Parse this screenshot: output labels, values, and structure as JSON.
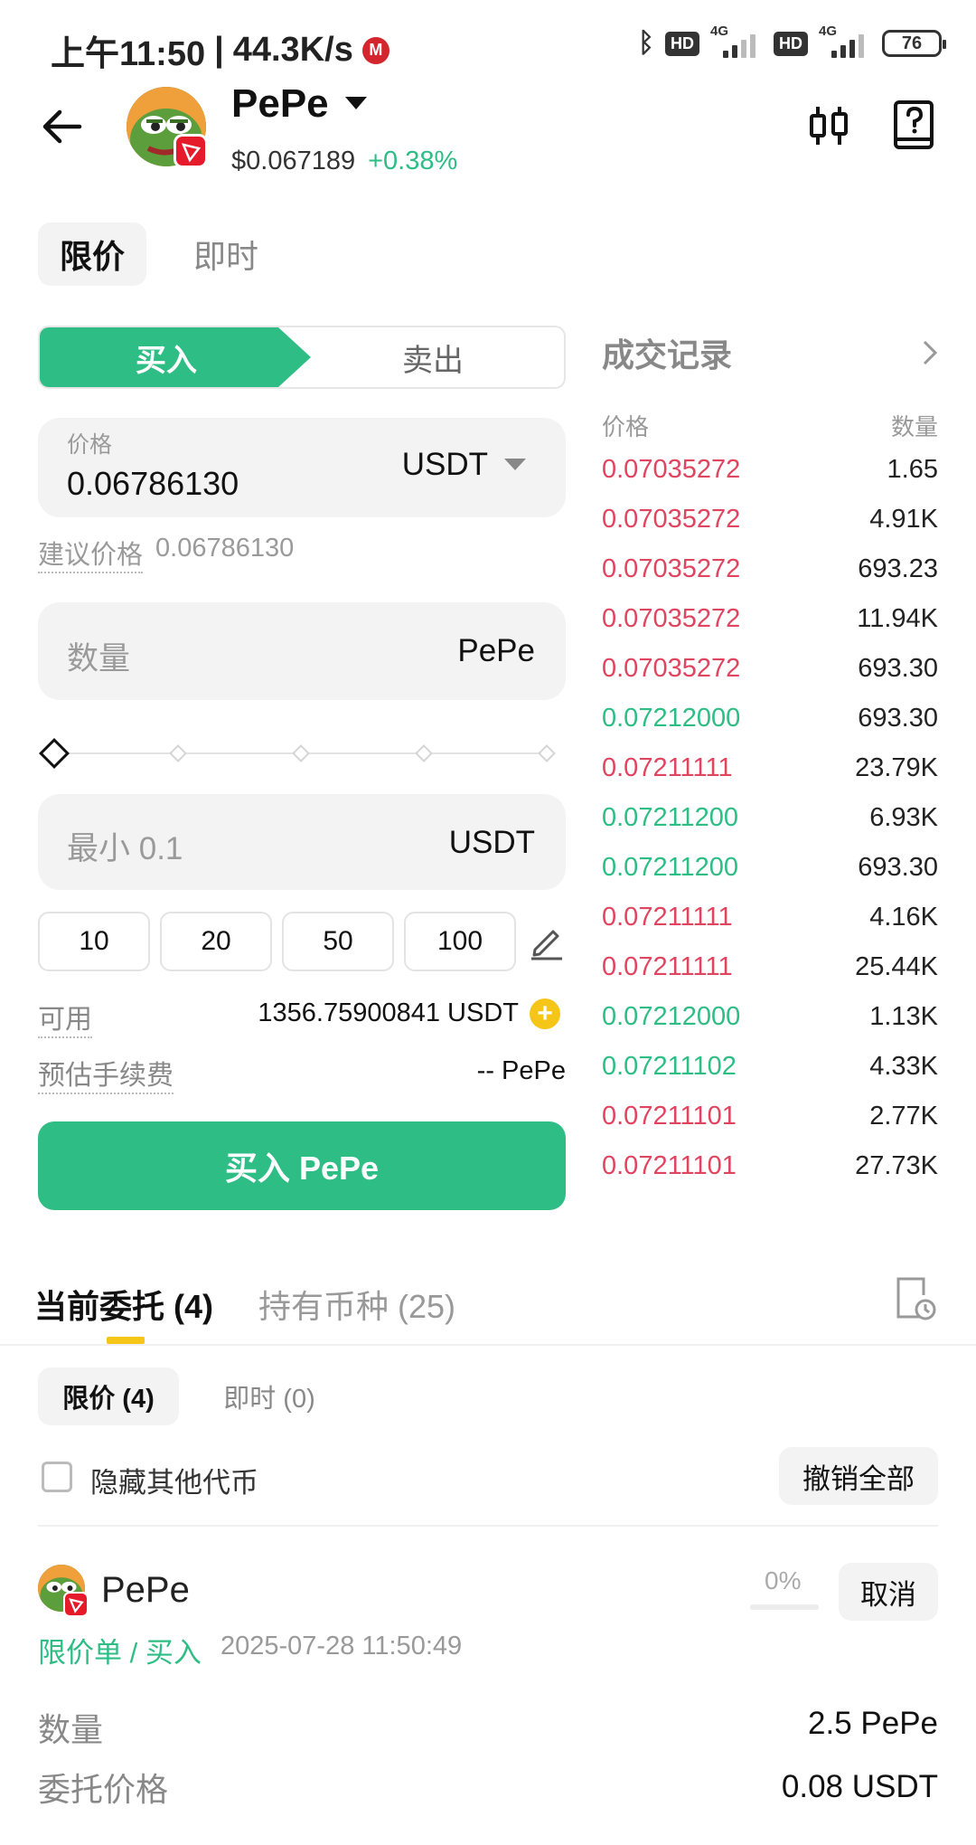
{
  "status_bar": {
    "time": "上午11:50",
    "separator": "|",
    "speed": "44.3K/s",
    "hd1": "HD",
    "net1": "4G",
    "hd2": "HD",
    "net2": "4G",
    "battery": "76"
  },
  "header": {
    "coin_name": "PePe",
    "price": "$0.067189",
    "change": "+0.38%"
  },
  "order_type_tabs": [
    "限价",
    "即时"
  ],
  "side_toggle": {
    "buy": "买入",
    "sell": "卖出"
  },
  "price_field": {
    "label": "价格",
    "value": "0.06786130",
    "currency": "USDT"
  },
  "suggested_price": {
    "label": "建议价格",
    "value": "0.06786130"
  },
  "quantity_field": {
    "placeholder": "数量",
    "unit": "PePe"
  },
  "slider": {
    "level": 0,
    "stops": 5
  },
  "amount_field": {
    "placeholder": "最小 0.1",
    "unit": "USDT"
  },
  "quick_amounts": [
    "10",
    "20",
    "50",
    "100"
  ],
  "available": {
    "label": "可用",
    "value": "1356.75900841 USDT"
  },
  "fee": {
    "label": "预估手续费",
    "value": "-- PePe"
  },
  "buy_button": "买入 PePe",
  "trade_history": {
    "title": "成交记录",
    "col_price": "价格",
    "col_qty": "数量",
    "rows": [
      {
        "price": "0.07035272",
        "qty": "1.65",
        "side": "sell"
      },
      {
        "price": "0.07035272",
        "qty": "4.91K",
        "side": "sell"
      },
      {
        "price": "0.07035272",
        "qty": "693.23",
        "side": "sell"
      },
      {
        "price": "0.07035272",
        "qty": "11.94K",
        "side": "sell"
      },
      {
        "price": "0.07035272",
        "qty": "693.30",
        "side": "sell"
      },
      {
        "price": "0.07212000",
        "qty": "693.30",
        "side": "buy"
      },
      {
        "price": "0.07211111",
        "qty": "23.79K",
        "side": "sell"
      },
      {
        "price": "0.07211200",
        "qty": "6.93K",
        "side": "buy"
      },
      {
        "price": "0.07211200",
        "qty": "693.30",
        "side": "buy"
      },
      {
        "price": "0.07211111",
        "qty": "4.16K",
        "side": "sell"
      },
      {
        "price": "0.07211111",
        "qty": "25.44K",
        "side": "sell"
      },
      {
        "price": "0.07212000",
        "qty": "1.13K",
        "side": "buy"
      },
      {
        "price": "0.07211102",
        "qty": "4.33K",
        "side": "buy"
      },
      {
        "price": "0.07211101",
        "qty": "2.77K",
        "side": "sell"
      },
      {
        "price": "0.07211101",
        "qty": "27.73K",
        "side": "sell"
      }
    ]
  },
  "bottom_tabs": {
    "orders": "当前委托 (4)",
    "holdings": "持有币种 (25)"
  },
  "sub_tabs": {
    "limit": "限价 (4)",
    "market": "即时 (0)"
  },
  "hide_others": "隐藏其他代币",
  "cancel_all": "撤销全部",
  "order": {
    "coin": "PePe",
    "progress": "0%",
    "cancel": "取消",
    "type": "限价单 / 买入",
    "time": "2025-07-28 11:50:49",
    "qty_label": "数量",
    "qty_value": "2.5 PePe",
    "price_label": "委托价格",
    "price_value": "0.08 USDT"
  },
  "colors": {
    "green": "#2ebd85",
    "red": "#e0455f",
    "accent_yellow": "#f5c518"
  }
}
